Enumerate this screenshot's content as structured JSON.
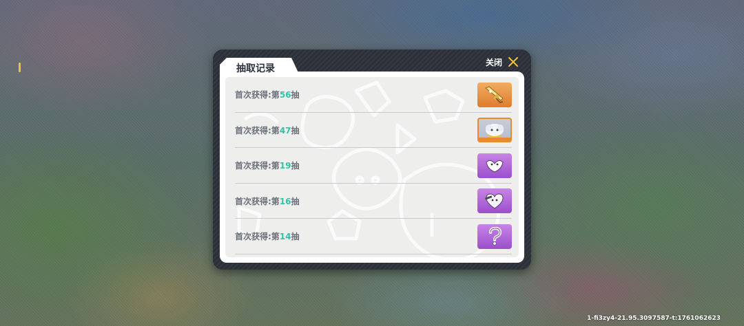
{
  "dialog": {
    "title": "抽取记录",
    "close_label": "关闭"
  },
  "records": [
    {
      "prefix": "首次获得:第",
      "number": "56",
      "suffix": "抽",
      "item_icon": "golden-rifle-icon",
      "rarity_color": "#e88b2e"
    },
    {
      "prefix": "首次获得:第",
      "number": "47",
      "suffix": "抽",
      "item_icon": "cloud-character-icon",
      "rarity_color": "#e88b2e"
    },
    {
      "prefix": "首次获得:第",
      "number": "19",
      "suffix": "抽",
      "item_icon": "wings-emote-icon",
      "rarity_color": "#a55ad4"
    },
    {
      "prefix": "首次获得:第",
      "number": "16",
      "suffix": "抽",
      "item_icon": "heart-character-icon",
      "rarity_color": "#a55ad4"
    },
    {
      "prefix": "首次获得:第",
      "number": "14",
      "suffix": "抽",
      "item_icon": "question-mark-icon",
      "rarity_color": "#a55ad4"
    }
  ],
  "build_info": "1-fi3zy4-21.95.3097587-t:1761062623",
  "colors": {
    "accent_yellow": "#f0c431",
    "number_teal": "#2ec3a8",
    "panel_dark": "#2c3039"
  }
}
